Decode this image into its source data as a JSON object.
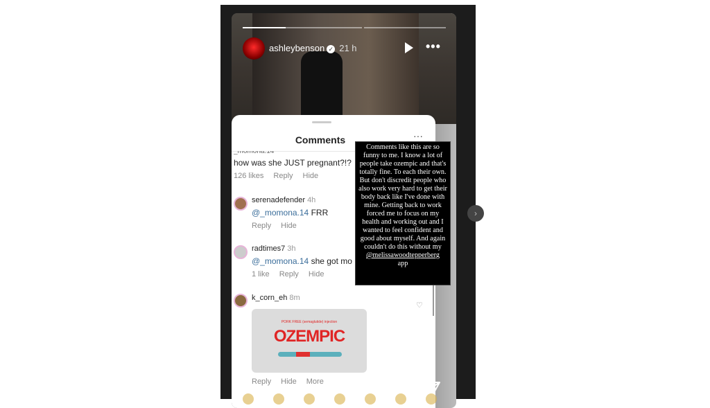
{
  "story": {
    "username": "ashleybenson",
    "time": "21 h",
    "progress": 0.22,
    "segments": 2
  },
  "comments_sheet": {
    "title": "Comments",
    "comments": [
      {
        "username": "_momona.14",
        "ago": "4h",
        "text": "how was she JUST pregnant?!?",
        "likes": "126 likes",
        "reply": "Reply",
        "hide": "Hide"
      },
      {
        "username": "serenadefender",
        "ago": "4h",
        "mention": "@_momona.14",
        "text": "FRR",
        "reply": "Reply",
        "hide": "Hide"
      },
      {
        "username": "radtimes7",
        "ago": "3h",
        "mention": "@_momona.14",
        "text": "she got mo",
        "likes": "1 like",
        "reply": "Reply",
        "hide": "Hide"
      },
      {
        "username": "k_corn_eh",
        "ago": "8m",
        "reply": "Reply",
        "hide": "Hide",
        "more": "More",
        "image": {
          "brand": "OZEMPIC",
          "tagline": "PORK FREE (semaglutide) injection"
        }
      }
    ]
  },
  "overlay_text": {
    "body": "Comments like this are so funny to me. I know a lot of people take ozempic and that's totally fine. To each their own. But don't discredit people who also work very hard to get their body back like I've done with mine. Getting back to work forced me to focus on my health and working out and I wanted to feel confident and good about myself. And again couldn't do this without my",
    "mention": "@melissawoodtepperberg",
    "tail": "app"
  },
  "icons": {
    "verified": "verified-badge-icon",
    "play": "play-icon",
    "more": "more-icon",
    "heart": "heart-icon",
    "send": "send-icon"
  }
}
